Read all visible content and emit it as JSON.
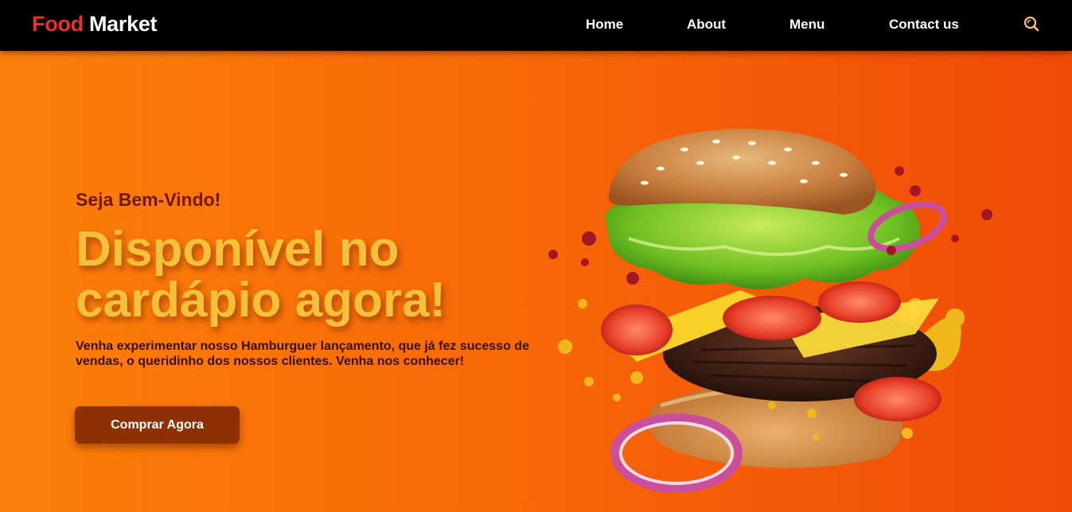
{
  "brand": {
    "part1": "Food",
    "part2": "Market"
  },
  "nav": {
    "home": "Home",
    "about": "About",
    "menu": "Menu",
    "contact": "Contact us",
    "search_icon": "search-icon"
  },
  "hero": {
    "welcome": "Seja Bem-Vindo!",
    "headline_line1": "Disponível no",
    "headline_line2": "cardápio agora!",
    "description": "Venha experimentar nosso Hamburguer lançamento, que já fez sucesso de vendas, o queridinho dos nossos clientes. Venha nos conhecer!",
    "cta_label": "Comprar Agora",
    "image": "burger-image"
  },
  "colors": {
    "navbar": "#000000",
    "brand_food": "#e8302e",
    "brand_market": "#ffffff",
    "headline": "#f6c03b",
    "welcome": "#6e1803",
    "cta_background": "#8d3004",
    "background_start": "#fb7f0b",
    "background_end": "#f04a08"
  }
}
